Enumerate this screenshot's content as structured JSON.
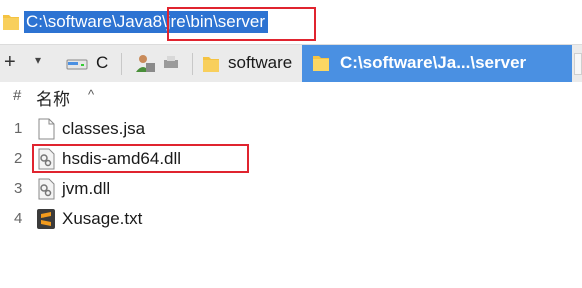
{
  "address_bar": {
    "path": "C:\\software\\Java8\\jre\\bin\\server"
  },
  "tabs": {
    "new_tab_symbol": "+",
    "dropdown_symbol": "▾",
    "items": [
      {
        "label": "C",
        "icon": "drive-icon",
        "active": false
      },
      {
        "label": "",
        "icon": "user-folder-icon",
        "active": false
      },
      {
        "label": "software",
        "icon": "folder-icon",
        "active": false
      },
      {
        "label": "C:\\software\\Ja...\\server",
        "icon": "folder-icon",
        "active": true
      }
    ]
  },
  "file_list": {
    "index_header": "#",
    "name_header": "名称",
    "sort_indicator": "^",
    "rows": [
      {
        "index": "1",
        "name": "classes.jsa",
        "icon": "blank-file-icon"
      },
      {
        "index": "2",
        "name": "hsdis-amd64.dll",
        "icon": "dll-gear-icon"
      },
      {
        "index": "3",
        "name": "jvm.dll",
        "icon": "dll-gear-icon"
      },
      {
        "index": "4",
        "name": "Xusage.txt",
        "icon": "sublime-text-icon"
      }
    ]
  },
  "colors": {
    "selection_blue": "#2d73d2",
    "active_tab_blue": "#4a90e2",
    "annotation_red": "#e0242f",
    "folder_yellow": "#f5c342"
  }
}
